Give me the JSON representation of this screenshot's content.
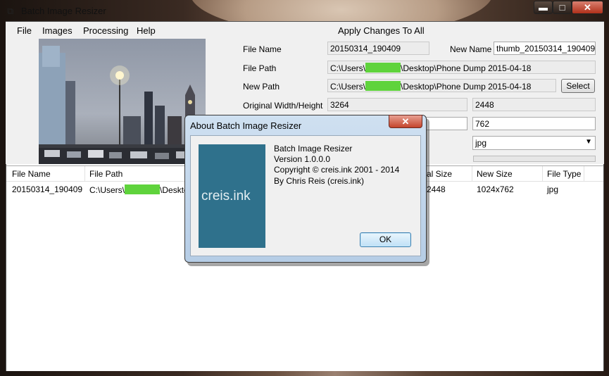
{
  "window": {
    "title": "Batch Image Resizer",
    "min_glyph": "▬",
    "max_glyph": "□",
    "close_glyph": "✕",
    "icon": "app-icon"
  },
  "menu": {
    "items": [
      "File",
      "Images",
      "Processing",
      "Help"
    ],
    "apply_all": "Apply Changes To All"
  },
  "details": {
    "file_name_label": "File Name",
    "file_name": "20150314_190409",
    "new_name_label": "New Name",
    "new_name": "thumb_20150314_190409",
    "file_path_label": "File Path",
    "file_path_prefix": "C:\\Users\\",
    "file_path_suffix": "\\Desktop\\Phone Dump 2015-04-18",
    "new_path_label": "New Path",
    "new_path_prefix": "C:\\Users\\",
    "new_path_suffix": "\\Desktop\\Phone Dump 2015-04-18",
    "select_button": "Select",
    "original_wh_label": "Original Width/Height",
    "original_width": "3264",
    "original_height": "2448",
    "new_width": "1024",
    "new_height": "762",
    "format": "jpg",
    "progress": 0
  },
  "list": {
    "columns": [
      "File Name",
      "File Path",
      "al Size",
      "New Size",
      "File Type"
    ],
    "rows": [
      {
        "file_name": "20150314_190409",
        "path_prefix": "C:\\Users\\",
        "path_suffix": "\\Desktop",
        "original_size": "2448",
        "new_size": "1024x762",
        "file_type": "jpg"
      }
    ]
  },
  "about_dialog": {
    "title": "About Batch Image Resizer",
    "close_glyph": "✕",
    "logo_text": "creis.ink",
    "product": "Batch Image Resizer",
    "version": "Version 1.0.0.0",
    "copyright": "Copyright © creis.ink 2001 - 2014",
    "author": "By Chris Reis (creis.ink)",
    "ok_button": "OK"
  },
  "colors": {
    "redaction": "#5fd33c",
    "logo_bg": "#2f718c"
  }
}
